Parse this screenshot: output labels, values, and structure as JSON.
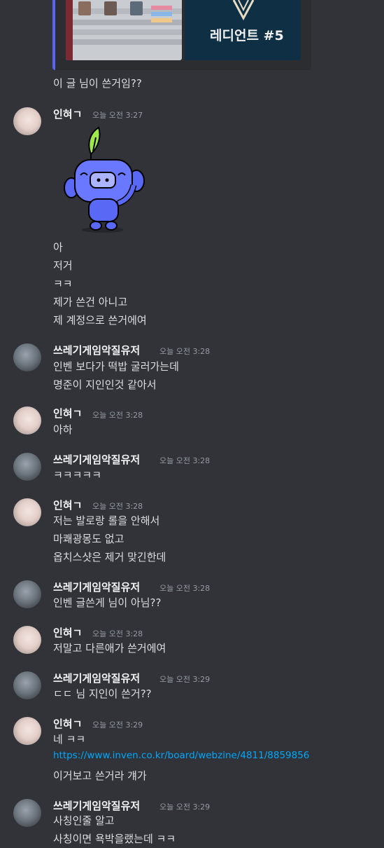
{
  "embed": {
    "rank_title": "레디언트 #5",
    "rank_sub": "",
    "colors": {
      "accent": "#5865f2",
      "rank_bg": "#0f2f45"
    }
  },
  "messages": [
    {
      "text": "이 글 님이 쓴거임??"
    },
    {
      "user": "인혀ㄱ",
      "time": "오늘 오전 3:27",
      "lines": [
        "아",
        "저거",
        "ㅋㅋ",
        "제가 쓴건 아니고",
        "제 계정으로 쓴거에여"
      ],
      "sticker": "wumpus-sticker"
    },
    {
      "user": "쓰레기게임악질유저",
      "time": "오늘 오전 3:28",
      "lines": [
        "인벤 보다가 떡밥 굴러가는데",
        "명준이 지인인것 같아서"
      ]
    },
    {
      "user": "인혀ㄱ",
      "time": "오늘 오전 3:28",
      "lines": [
        "아하"
      ]
    },
    {
      "user": "쓰레기게임악질유저",
      "time": "오늘 오전 3:28",
      "lines": [
        "ㅋㅋㅋㅋㅋ"
      ]
    },
    {
      "user": "인혀ㄱ",
      "time": "오늘 오전 3:28",
      "lines": [
        "저는 발로랑 롤을 안해서",
        "마쾌광몽도 없고",
        "옵치스샷은 제거 맞긴한데"
      ]
    },
    {
      "user": "쓰레기게임악질유저",
      "time": "오늘 오전 3:28",
      "lines": [
        "인벤 글쓴게  님이 아님??"
      ]
    },
    {
      "user": "인혀ㄱ",
      "time": "오늘 오전 3:28",
      "lines": [
        "저말고 다른애가 쓴거에여"
      ]
    },
    {
      "user": "쓰레기게임악질유저",
      "time": "오늘 오전 3:29",
      "lines": [
        "ㄷㄷ 님 지인이 쓴거??"
      ]
    },
    {
      "user": "인혀ㄱ",
      "time": "오늘 오전 3:29",
      "lines": [
        "네 ㅋㅋ",
        "https://www.inven.co.kr/board/webzine/4811/8859856",
        "이거보고 쓴거라 걔가"
      ]
    },
    {
      "user": "쓰레기게임악질유저",
      "time": "오늘 오전 3:29",
      "lines": [
        "사칭인줄 알고",
        "사칭이면 욕박을랬는데 ㅋㅋ"
      ]
    }
  ],
  "colors": {
    "background": "#313338",
    "username": "#f2f3f5",
    "timestamp": "#949ba4",
    "link": "#00a8fc"
  }
}
